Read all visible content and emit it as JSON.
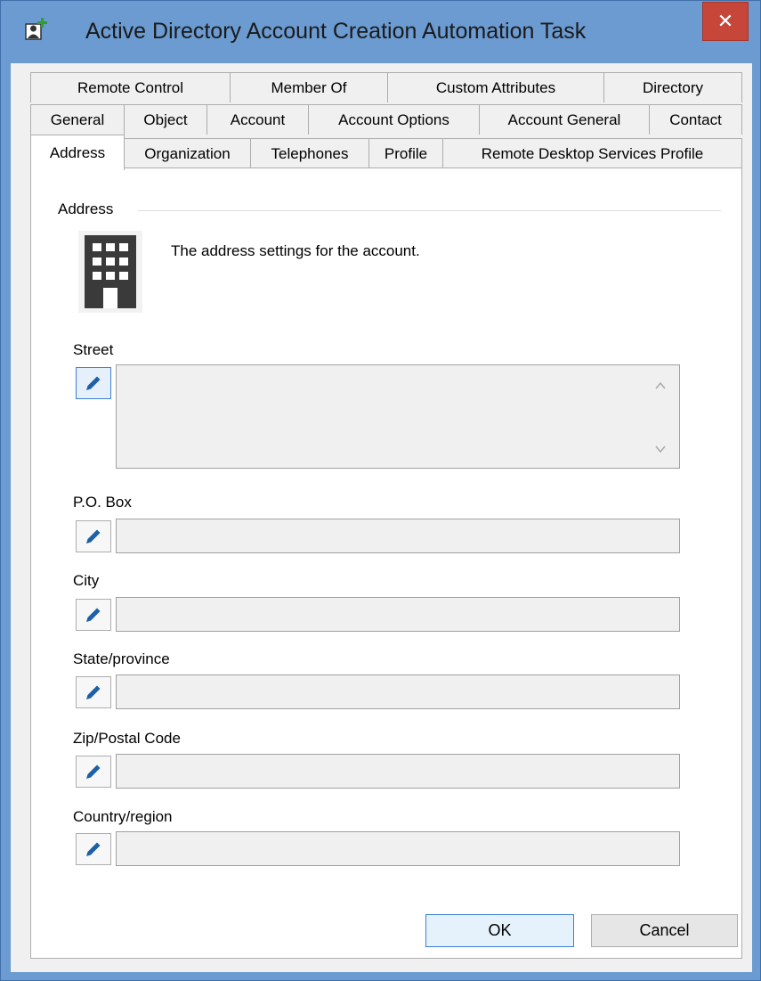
{
  "window": {
    "title": "Active Directory Account Creation Automation Task",
    "close_glyph": "✕"
  },
  "tabs": {
    "row1": [
      "Remote Control",
      "Member Of",
      "Custom Attributes",
      "Directory"
    ],
    "row2": [
      "General",
      "Object",
      "Account",
      "Account Options",
      "Account General",
      "Contact"
    ],
    "row3": [
      "Address",
      "Organization",
      "Telephones",
      "Profile",
      "Remote Desktop Services Profile"
    ],
    "selected": "Address"
  },
  "panel": {
    "group_title": "Address",
    "description": "The address settings for the account.",
    "icon": "building-icon"
  },
  "fields": [
    {
      "label": "Street",
      "value": ""
    },
    {
      "label": "P.O. Box",
      "value": ""
    },
    {
      "label": "City",
      "value": ""
    },
    {
      "label": "State/province",
      "value": ""
    },
    {
      "label": "Zip/Postal Code",
      "value": ""
    },
    {
      "label": "Country/region",
      "value": ""
    }
  ],
  "buttons": {
    "ok": "OK",
    "cancel": "Cancel"
  },
  "colors": {
    "title_bar": "#6b9bd1",
    "close_button": "#c7463a",
    "accent": "#3c7fd6",
    "pencil": "#1d5fa8"
  }
}
